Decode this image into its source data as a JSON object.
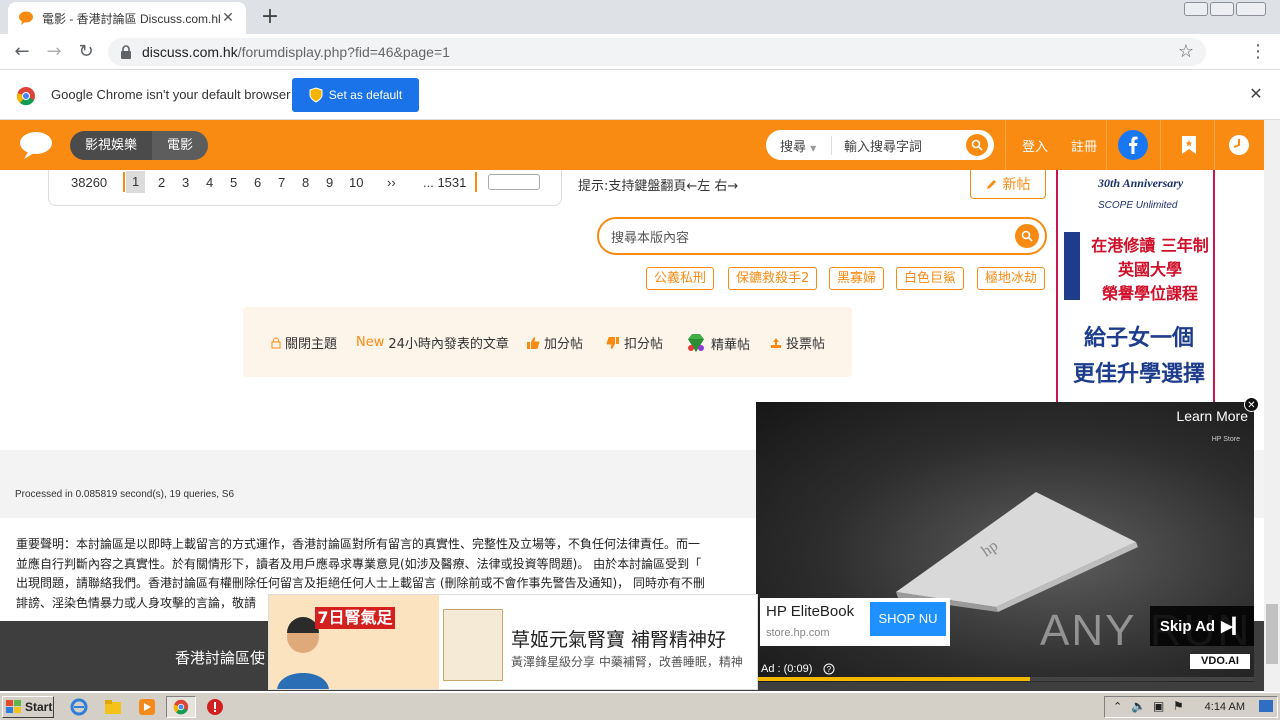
{
  "browser": {
    "tab_title": "電影 - 香港討論區 Discuss.com.hk -",
    "url_host": "discuss.com.hk",
    "url_path": "/forumdisplay.php?fid=46&page=1",
    "infobar_text": "Google Chrome isn't your default browser",
    "set_default_label": "Set as default"
  },
  "header": {
    "category": "影視娛樂",
    "subcategory": "電影",
    "search_type": "搜尋",
    "search_placeholder": "輸入搜尋字詞",
    "login": "登入",
    "register": "註冊"
  },
  "pagination": {
    "total": "38260",
    "pages": [
      "1",
      "2",
      "3",
      "4",
      "5",
      "6",
      "7",
      "8",
      "9",
      "10"
    ],
    "next": "››",
    "last": "... 1531"
  },
  "hint": "提示:支持鍵盤翻頁←左 右→",
  "new_post_label": "新帖",
  "board_search_placeholder": "搜尋本版內容",
  "tags": [
    "公義私刑",
    "保鑣救殺手2",
    "黑寡婦",
    "白色巨鯊",
    "極地冰劫"
  ],
  "filters": {
    "closed": "關閉主題",
    "new_badge": "New",
    "recent": "24小時內發表的文章",
    "plus": "加分帖",
    "minus": "扣分帖",
    "digest": "精華帖",
    "poll": "投票帖"
  },
  "processed": "Processed in 0.085819 second(s), 19 queries, S6",
  "disclaimer": [
    "重要聲明：本討論區是以即時上載留言的方式運作，香港討論區對所有留言的真實性、完整性及立場等，不負任何法律責任。而一",
    "並應自行判斷內容之真實性。於有關情形下，讀者及用戶應尋求專業意見(如涉及醫療、法律或投資等問題)。 由於本討論區受到「",
    "出現問題，請聯絡我們。香港討論區有權刪除任何留言及拒絕任何人士上載留言 (刪除前或不會作事先警告及通知)， 同時亦有不刪",
    "誹謗、淫染色情暴力或人身攻擊的言論，敬請"
  ],
  "footer_text": "香港討論區使",
  "side_ad": {
    "line1": "30th Anniversary",
    "line2": "SCOPE Unlimited",
    "red1": "在港修讀 三年制",
    "red2": "英國大學",
    "red3": "榮譽學位課程",
    "blue1": "給子女一個",
    "blue2": "更佳升學選擇"
  },
  "video_ad": {
    "learn_more": "Learn More",
    "brand": "HP Store",
    "product": "HP EliteBook",
    "site": "store.hp.com",
    "shop_label": "SHOP NU",
    "skip_label": "Skip Ad",
    "vdo_label": "VDO.AI",
    "ad_time": "Ad : (0:09)",
    "progress": 0.55,
    "watermark": "ANY RUN"
  },
  "banner_ad": {
    "badge": "7日腎氣足",
    "headline": "草姬元氣腎寶 補腎精神好",
    "sub": "黃澤鋒星級分享 中藥補腎，改善睡眠，精神"
  },
  "taskbar": {
    "start_label": "Start",
    "clock": "4:14 AM"
  },
  "colors": {
    "brand_orange": "#f98b13",
    "chrome_blue": "#1a73e8"
  }
}
